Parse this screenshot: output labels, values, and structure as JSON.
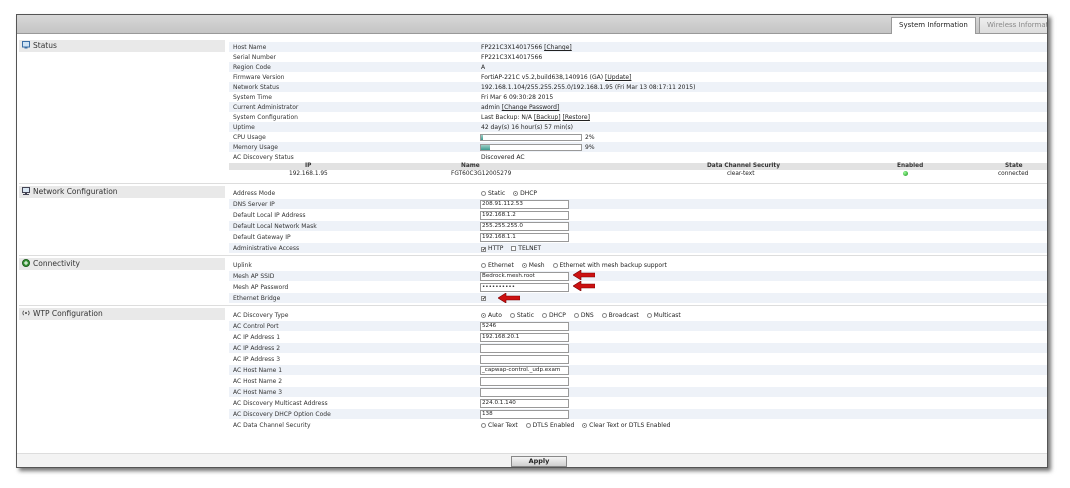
{
  "tabs": [
    {
      "label": "System Information",
      "active": true
    },
    {
      "label": "Wireless Informat",
      "active": false
    }
  ],
  "sections": {
    "status": "Status",
    "network": "Network Configuration",
    "connectivity": "Connectivity",
    "wtp": "WTP Configuration"
  },
  "status": {
    "host_name_label": "Host Name",
    "host_name_value": "FP221C3X14017566",
    "host_name_change": "[Change]",
    "serial_label": "Serial Number",
    "serial_value": "FP221C3X14017566",
    "region_label": "Region Code",
    "region_value": "A",
    "firmware_label": "Firmware Version",
    "firmware_value": "FortiAP-221C v5.2,build638,140916 (GA)",
    "firmware_update": "[Update]",
    "netstatus_label": "Network Status",
    "netstatus_value": "192.168.1.104/255.255.255.0/192.168.1.95 (Fri Mar 13 08:17:11 2015)",
    "systime_label": "System Time",
    "systime_value": "Fri Mar 6 09:30:28 2015",
    "admin_label": "Current Administrator",
    "admin_value": "admin",
    "admin_change": "[Change Password]",
    "sysconf_label": "System Configuration",
    "sysconf_value": "Last Backup: N/A",
    "sysconf_backup": "[Backup]",
    "sysconf_restore": "[Restore]",
    "uptime_label": "Uptime",
    "uptime_value": "42 day(s) 16 hour(s) 57 min(s)",
    "cpu_label": "CPU Usage",
    "cpu_value": "2%",
    "cpu_fraction": 0.02,
    "mem_label": "Memory Usage",
    "mem_value": "9%",
    "mem_fraction": 0.09,
    "acdisc_label": "AC Discovery Status",
    "acdisc_value": "Discovered AC",
    "table_headers": [
      "IP",
      "Name",
      "Data Channel Security",
      "Enabled",
      "State"
    ],
    "table_row": {
      "ip": "192.168.1.95",
      "name": "FGT60C3G12005279",
      "security": "clear-text",
      "state": "connected"
    }
  },
  "network": {
    "addr_mode_label": "Address Mode",
    "addr_mode_options": [
      "Static",
      "DHCP"
    ],
    "dns_label": "DNS Server IP",
    "dns_value": "208.91.112.53",
    "local_ip_label": "Default Local IP Address",
    "local_ip_value": "192.168.1.2",
    "mask_label": "Default Local Network Mask",
    "mask_value": "255.255.255.0",
    "gateway_label": "Default Gateway IP",
    "gateway_value": "192.168.1.1",
    "admin_access_label": "Administrative Access",
    "admin_access_options": [
      "HTTP",
      "TELNET"
    ]
  },
  "connectivity": {
    "uplink_label": "Uplink",
    "uplink_options": [
      "Ethernet",
      "Mesh",
      "Ethernet with mesh backup support"
    ],
    "ssid_label": "Mesh AP SSID",
    "ssid_value": "Bedrock.mesh.root",
    "password_label": "Mesh AP Password",
    "password_value": "••••••••••",
    "bridge_label": "Ethernet Bridge"
  },
  "wtp": {
    "disc_type_label": "AC Discovery Type",
    "disc_type_options": [
      "Auto",
      "Static",
      "DHCP",
      "DNS",
      "Broadcast",
      "Multicast"
    ],
    "ctrl_port_label": "AC Control Port",
    "ctrl_port_value": "5246",
    "ip1_label": "AC IP Address 1",
    "ip1_value": "192.168.20.1",
    "ip2_label": "AC IP Address 2",
    "ip3_label": "AC IP Address 3",
    "host1_label": "AC Host Name 1",
    "host1_value": "_capwap-control._udp.exam",
    "host2_label": "AC Host Name 2",
    "host3_label": "AC Host Name 3",
    "mcast_label": "AC Discovery Multicast Address",
    "mcast_value": "224.0.1.140",
    "dhcp_opt_label": "AC Discovery DHCP Option Code",
    "dhcp_opt_value": "138",
    "dcs_label": "AC Data Channel Security",
    "dcs_options": [
      "Clear Text",
      "DTLS Enabled",
      "Clear Text or DTLS Enabled"
    ]
  },
  "apply_label": "Apply",
  "colors": {
    "annotation_arrow": "#cc1111",
    "alt_row": "#eef2f8",
    "progress_fill": "#3d9a8e"
  }
}
